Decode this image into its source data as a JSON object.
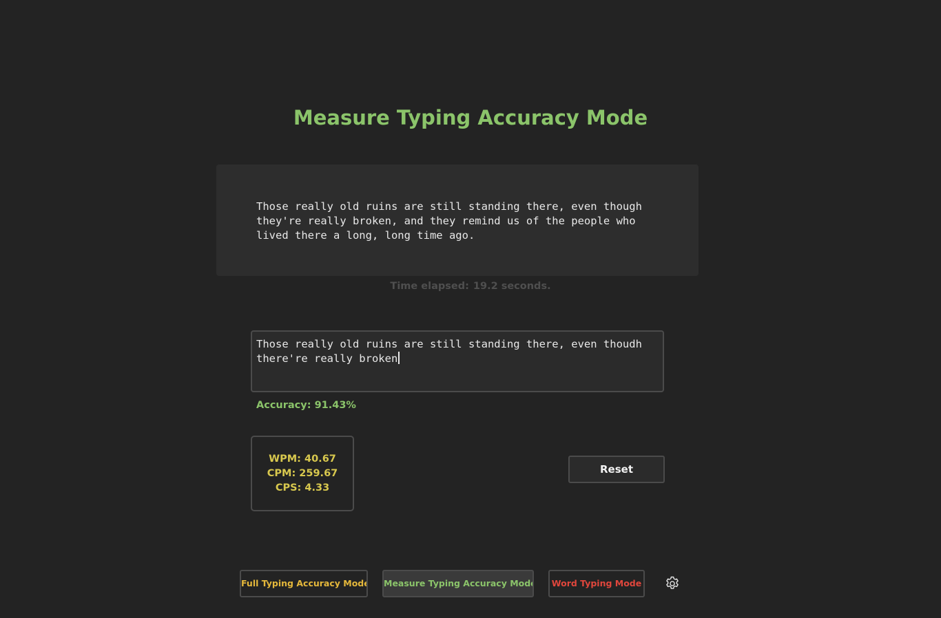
{
  "header": {
    "title": "Measure Typing Accuracy Mode"
  },
  "prompt": {
    "text": "Those really old ruins are still standing there, even though they're really broken, and they remind us of the people who lived there a long, long time ago."
  },
  "timer": {
    "label": "Time elapsed:",
    "value": "19.2 seconds."
  },
  "input": {
    "value": "Those really old ruins are still standing there, even thoudh there're really broken"
  },
  "accuracy": {
    "text": "Accuracy: 91.43%"
  },
  "stats": {
    "wpm": "WPM: 40.67",
    "cpm": "CPM: 259.67",
    "cps": "CPS: 4.33"
  },
  "actions": {
    "reset_label": "Reset"
  },
  "modes": {
    "full": "Full Typing Accuracy Mode",
    "measure": "Measure Typing Accuracy Mode",
    "word": "Word Typing Mode"
  },
  "colors": {
    "background": "#232323",
    "accent_green": "#8bc46a",
    "accent_yellow": "#d8c84e",
    "accent_orange": "#e5b83b",
    "accent_red": "#e0463c"
  },
  "icons": {
    "settings": "gear-icon"
  }
}
